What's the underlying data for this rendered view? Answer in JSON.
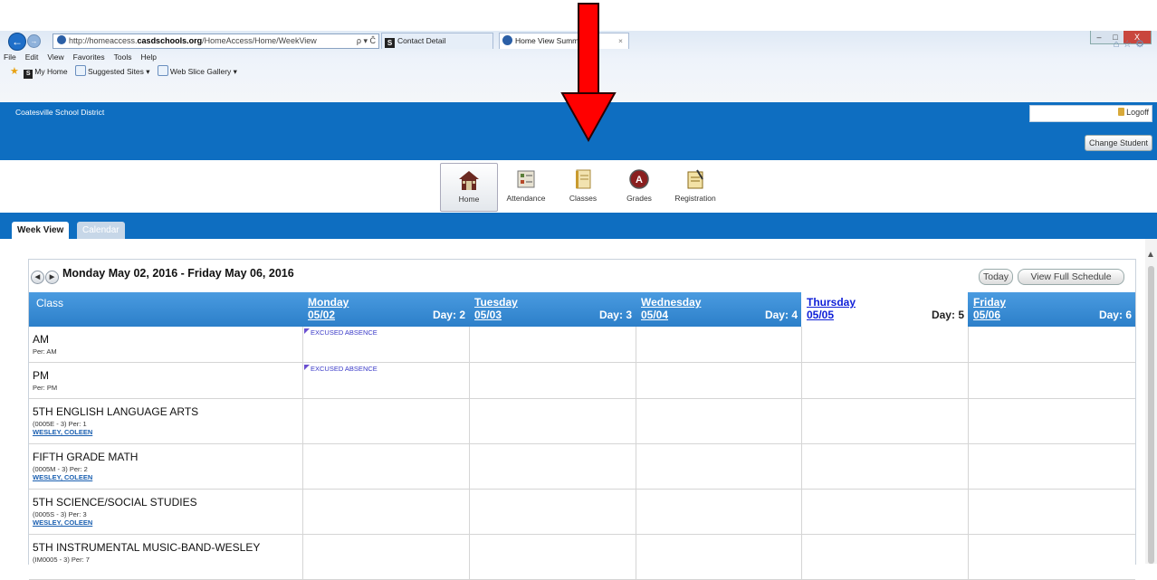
{
  "browser": {
    "url_prefix": "http://homeaccess.",
    "url_domain": "casdschools.org",
    "url_path": "/HomeAccess/Home/WeekView",
    "url_tools": "ρ ▾ Ĉ",
    "tabs": [
      {
        "label": "Contact Detail",
        "icon_glyph": "S"
      },
      {
        "label": "Home View Summ",
        "close_glyph": "×"
      }
    ],
    "menu": [
      "File",
      "Edit",
      "View",
      "Favorites",
      "Tools",
      "Help"
    ],
    "favorites": [
      {
        "label": "My Home",
        "icon_glyph": "S"
      },
      {
        "label": "Suggested Sites ▾"
      },
      {
        "label": "Web Slice Gallery ▾"
      }
    ],
    "window_buttons": [
      "–",
      "□",
      "X"
    ]
  },
  "header": {
    "district": "Coatesville School District",
    "logoff": "Logoff",
    "change_student": "Change Student"
  },
  "nav": [
    {
      "label": "Home",
      "icon": "home-icon",
      "active": true
    },
    {
      "label": "Attendance",
      "icon": "attendance-icon"
    },
    {
      "label": "Classes",
      "icon": "classes-icon"
    },
    {
      "label": "Grades",
      "icon": "grades-icon"
    },
    {
      "label": "Registration",
      "icon": "registration-icon"
    }
  ],
  "tabs": {
    "week_view": "Week View",
    "calendar": "Calendar"
  },
  "schedule": {
    "range": "Monday May 02, 2016 - Friday May 06, 2016",
    "today_btn": "Today",
    "full_btn": "View Full Schedule",
    "class_col": "Class",
    "days": [
      {
        "name": "Monday",
        "date": "05/02",
        "day": "Day: 2"
      },
      {
        "name": "Tuesday",
        "date": "05/03",
        "day": "Day: 3"
      },
      {
        "name": "Wednesday",
        "date": "05/04",
        "day": "Day: 4"
      },
      {
        "name": "Thursday",
        "date": "05/05",
        "day": "Day: 5",
        "today": true
      },
      {
        "name": "Friday",
        "date": "05/06",
        "day": "Day: 6"
      }
    ],
    "rows": [
      {
        "name": "AM",
        "period": "Per: AM",
        "teacher": "",
        "events": {
          "0": "EXCUSED ABSENCE"
        }
      },
      {
        "name": "PM",
        "period": "Per: PM",
        "teacher": "",
        "events": {
          "0": "EXCUSED ABSENCE"
        }
      },
      {
        "name": "5TH ENGLISH LANGUAGE ARTS",
        "period": "(0005E - 3) Per: 1",
        "teacher": "WESLEY, COLEEN",
        "events": {}
      },
      {
        "name": "FIFTH GRADE MATH",
        "period": "(0005M - 3) Per: 2",
        "teacher": "WESLEY, COLEEN",
        "events": {}
      },
      {
        "name": "5TH SCIENCE/SOCIAL STUDIES",
        "period": "(0005S - 3) Per: 3",
        "teacher": "WESLEY, COLEEN",
        "events": {}
      },
      {
        "name": "5TH INSTRUMENTAL MUSIC-BAND-WESLEY",
        "period": "(IM0005 - 3) Per: 7",
        "teacher": "",
        "events": {}
      }
    ]
  }
}
